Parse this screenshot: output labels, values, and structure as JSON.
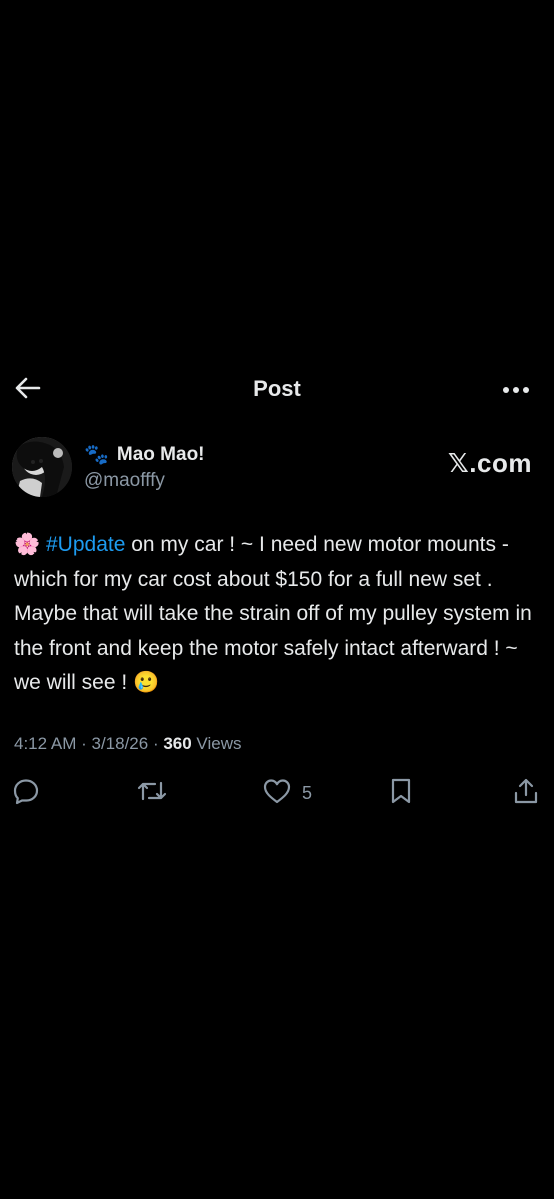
{
  "header": {
    "title": "Post",
    "back_icon": "arrow-left-icon",
    "more_icon": "more-horizontal-icon"
  },
  "author": {
    "display_name": "Mao Mao!",
    "name_emoji": "🐾",
    "handle": "@maofffy",
    "watermark": "𝕏.com"
  },
  "post": {
    "emoji_prefix": "🌸",
    "hashtag": "#Update",
    "text_main": " on my car ! ~ I need new motor mounts - which for my car cost about $150 for a full new set . Maybe that will take the strain off of my pulley system in the front and keep the motor safely intact afterward ! ~ we will see ! ",
    "emoji_suffix": "🥲"
  },
  "meta": {
    "time": "4:12 AM",
    "separator": " · ",
    "date": "3/18/26",
    "views_count": "360",
    "views_label": " Views"
  },
  "actions": {
    "reply_icon": "reply-icon",
    "repost_icon": "repost-icon",
    "like_icon": "heart-icon",
    "like_count": "5",
    "bookmark_icon": "bookmark-icon",
    "share_icon": "share-icon"
  },
  "colors": {
    "background": "#000000",
    "text_primary": "#e7e9ea",
    "text_secondary": "#8b98a5",
    "accent": "#1d9bf0"
  }
}
